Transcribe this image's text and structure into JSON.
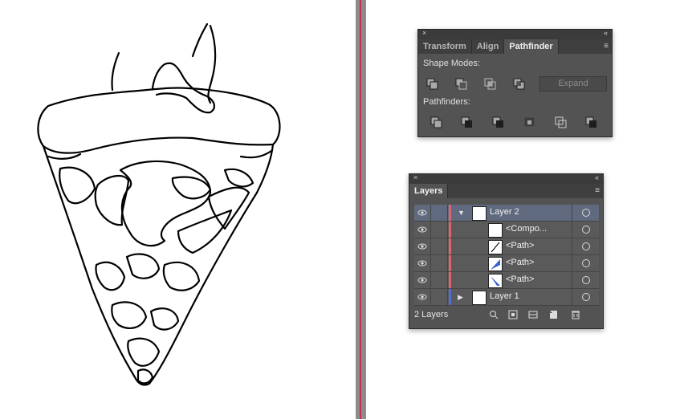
{
  "pathfinder_panel": {
    "close_glyph": "×",
    "collapse_glyph": "«",
    "tabs": [
      "Transform",
      "Align",
      "Pathfinder"
    ],
    "active_tab": "Pathfinder",
    "menu_glyph": "≡",
    "shape_modes_label": "Shape Modes:",
    "pathfinders_label": "Pathfinders:",
    "expand_label": "Expand",
    "shape_mode_icons": [
      "unite-icon",
      "minus-front-icon",
      "intersect-icon",
      "exclude-icon"
    ],
    "pathfinder_icons": [
      "divide-icon",
      "trim-icon",
      "merge-icon",
      "crop-icon",
      "outline-icon",
      "minus-back-icon"
    ]
  },
  "layers_panel": {
    "close_glyph": "×",
    "collapse_glyph": "«",
    "tab": "Layers",
    "menu_glyph": "≡",
    "rows": [
      {
        "name": "Layer 2",
        "color": "#e06470",
        "expanded": true,
        "selected": true
      },
      {
        "name": "<Compo...",
        "color": "#e06470"
      },
      {
        "name": "<Path>",
        "color": "#e06470"
      },
      {
        "name": "<Path>",
        "color": "#e06470"
      },
      {
        "name": "<Path>",
        "color": "#e06470"
      },
      {
        "name": "Layer 1",
        "color": "#4f6fd8",
        "expanded": false
      }
    ],
    "count_label": "2 Layers",
    "footer_icons": [
      "locate-object-icon",
      "make-clipping-mask-icon",
      "create-sublayer-icon",
      "create-layer-icon",
      "delete-icon"
    ]
  },
  "colors": {
    "panel_bg": "#535353",
    "guide_line": "#c4324a",
    "layer2_color": "#e06470",
    "layer1_color": "#4f6fd8",
    "selection": "#5f6a7e"
  }
}
